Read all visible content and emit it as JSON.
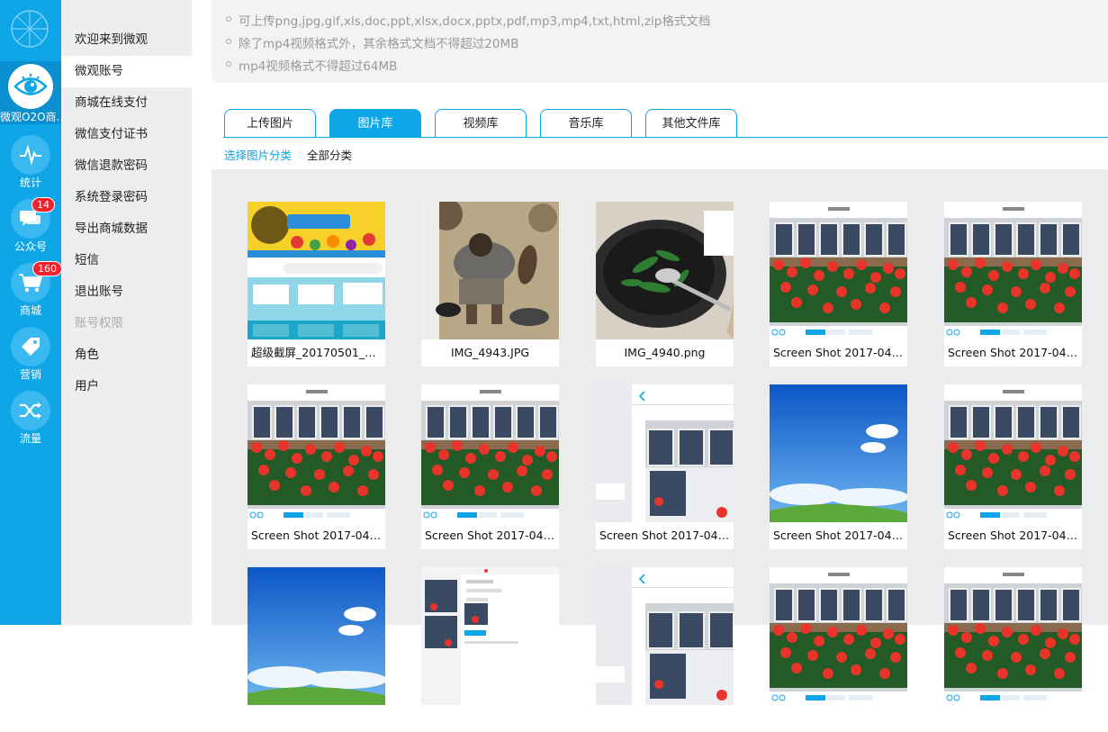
{
  "app": {
    "title": "微观O2O商..."
  },
  "rail": [
    {
      "label": "微观O2O商...",
      "icon": "eye-icon",
      "active": true
    },
    {
      "label": "统计",
      "icon": "pulse-icon"
    },
    {
      "label": "公众号",
      "icon": "chat-icon",
      "badge": "14"
    },
    {
      "label": "商城",
      "icon": "cart-icon",
      "badge": "160"
    },
    {
      "label": "营销",
      "icon": "tag-icon"
    },
    {
      "label": "流量",
      "icon": "shuffle-icon"
    }
  ],
  "menu": [
    {
      "label": "欢迎来到微观"
    },
    {
      "label": "微观账号",
      "active": true
    },
    {
      "label": "商城在线支付"
    },
    {
      "label": "微信支付证书"
    },
    {
      "label": "微信退款密码"
    },
    {
      "label": "系统登录密码"
    },
    {
      "label": "导出商城数据"
    },
    {
      "label": "短信"
    },
    {
      "label": "退出账号"
    },
    {
      "label": "账号权限",
      "group": true
    },
    {
      "label": "角色"
    },
    {
      "label": "用户"
    }
  ],
  "notice": [
    "可上传png,jpg,gif,xls,doc,ppt,xlsx,docx,pptx,pdf,mp3,mp4,txt,html,zip格式文档",
    "除了mp4视频格式外，其余格式文档不得超过20MB",
    "mp4视频格式不得超过64MB"
  ],
  "tabs": [
    {
      "label": "上传图片"
    },
    {
      "label": "图片库",
      "active": true
    },
    {
      "label": "视频库"
    },
    {
      "label": "音乐库"
    },
    {
      "label": "其他文件库"
    }
  ],
  "category": {
    "label": "选择图片分类",
    "value": "全部分类"
  },
  "files": [
    {
      "name": "超级截屏_20170501_1...",
      "thumb": "promo"
    },
    {
      "name": "IMG_4943.JPG",
      "thumb": "worker"
    },
    {
      "name": "IMG_4940.png",
      "thumb": "wok"
    },
    {
      "name": "Screen Shot 2017-04-...",
      "thumb": "flowers"
    },
    {
      "name": "Screen Shot 2017-04-...",
      "thumb": "flowers"
    },
    {
      "name": "Screen Shot 2017-04-...",
      "thumb": "flowers"
    },
    {
      "name": "Screen Shot 2017-04-...",
      "thumb": "flowers"
    },
    {
      "name": "Screen Shot 2017-04-...",
      "thumb": "phone"
    },
    {
      "name": "Screen Shot 2017-04-...",
      "thumb": "sky"
    },
    {
      "name": "Screen Shot 2017-04-...",
      "thumb": "flowers"
    },
    {
      "name": "",
      "thumb": "sky"
    },
    {
      "name": "",
      "thumb": "admin"
    },
    {
      "name": "",
      "thumb": "phone"
    },
    {
      "name": "",
      "thumb": "flowers"
    },
    {
      "name": "",
      "thumb": "flowers"
    }
  ],
  "colors": {
    "primary": "#0fa6e8",
    "badge": "#f5222d",
    "menu_bg": "#eceef0",
    "gallery_bg": "#ebecee"
  }
}
